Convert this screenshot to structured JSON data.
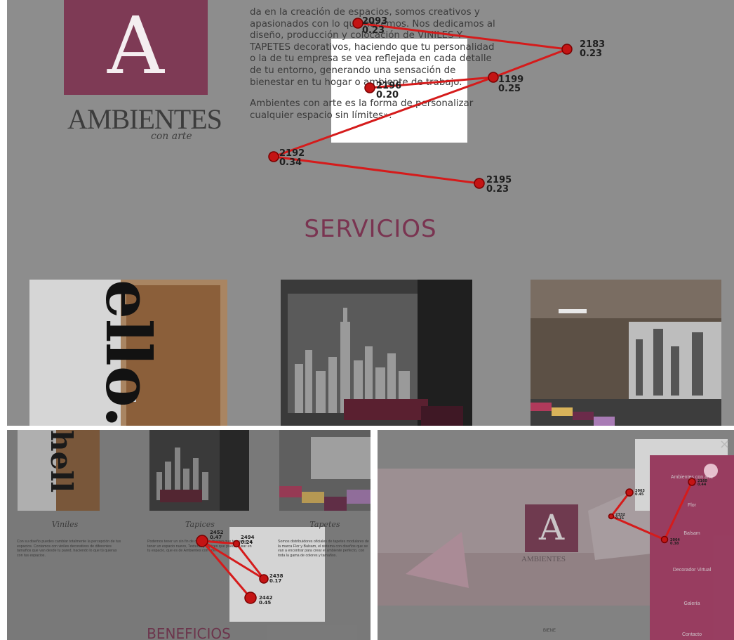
{
  "top": {
    "logo_letter": "A",
    "logo_word": "AMBIENTES",
    "logo_sub": "con arte",
    "about_p1": "da en la creación de espacios, somos creativos y apasionados con lo que hacemos. Nos dedicamos al diseño, producción y colocación de VINILES Y TAPETES decorativos, haciendo que tu personalidad o la de tu empresa se vea reflejada en cada detalle de tu entorno, generando una sensación de bienestar en tu hogar o ambiente de trabajo.",
    "about_p2": "Ambientes con arte es la forma de personalizar cualquier espacio sin límites».",
    "services_title": "SERVICIOS",
    "photo1_text": "ello.",
    "gaze_points": [
      {
        "id": "2093",
        "dur": "0.23"
      },
      {
        "id": "2183",
        "dur": "0.23"
      },
      {
        "id": "2196",
        "dur": "0.20"
      },
      {
        "id": "1199",
        "dur": "0.25"
      },
      {
        "id": "2192",
        "dur": "0.34"
      },
      {
        "id": "2195",
        "dur": "0.23"
      }
    ]
  },
  "bottom_left": {
    "photo1_text": "hell",
    "services": [
      {
        "name": "Viniles",
        "desc": "Con su diseño puedes cambiar totalmente la percepción de tus espacios. Contamos con viniles decorativos de diferentes tamaños que van desde tu pared, haciendo lo que tú quieras con tus espacios."
      },
      {
        "name": "Tapices",
        "desc": "Podemos tener un sin fin de diseños e imagen que te ayudan a tener un espacio nuevo, Texturas y tapices que puedes usar en tu espacio, que es de Ambientes con arte."
      },
      {
        "name": "Tapetes",
        "desc": "Somos distribuidores oficiales de tapetes modulares de la marca Flor y Balsam, el sistema con diseños que se van a encontrar para crear el ambiente perfecto, con toda la gama de colores y tamaños."
      }
    ],
    "benefits_title": "BENEFICIOS",
    "gaze_points": [
      {
        "id": "2452",
        "dur": "0.47"
      },
      {
        "id": "2494",
        "dur": "0.24"
      },
      {
        "id": "2438",
        "dur": "0.17"
      },
      {
        "id": "2442",
        "dur": "0.45"
      }
    ]
  },
  "bottom_right": {
    "logo_letter": "A",
    "logo_word": "AMBIENTES",
    "close": "×",
    "menu": [
      "Ambientes con arte",
      "Flor",
      "Balsam",
      "Decorador Virtual",
      "Galería",
      "Contacto"
    ],
    "footer": "BIENE",
    "gaze_points": [
      {
        "id": "2063",
        "dur": "0.45"
      },
      {
        "id": "2332",
        "dur": "0.21"
      },
      {
        "id": "2160",
        "dur": "0.44"
      },
      {
        "id": "2064",
        "dur": "0.38"
      }
    ]
  },
  "colors": {
    "brand": "#7e3a55",
    "gaze": "#d51b1b",
    "menu": "#b23e6b"
  }
}
